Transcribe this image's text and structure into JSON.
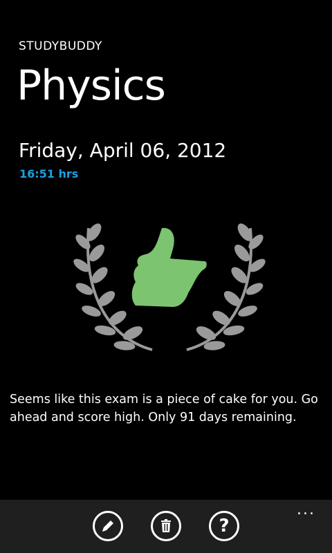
{
  "app": {
    "title": "STUDYBUDDY"
  },
  "page": {
    "title": "Physics",
    "date": "Friday, April 06, 2012",
    "time": "16:51 hrs"
  },
  "emblem": {
    "icon": "thumbs-up-laurel-icon",
    "thumb_color": "#7dc470",
    "laurel_color": "#9a9a9a"
  },
  "message": "Seems like this exam is a piece of cake for you. Go ahead and score high. Only 91 days remaining.",
  "app_bar": {
    "buttons": [
      {
        "icon": "edit-pencil-icon"
      },
      {
        "icon": "delete-trash-icon"
      },
      {
        "icon": "help-question-icon",
        "glyph": "?"
      }
    ],
    "more_label": "..."
  },
  "colors": {
    "background": "#000000",
    "accent": "#1ba1e2",
    "app_bar": "#1f1f1f"
  }
}
